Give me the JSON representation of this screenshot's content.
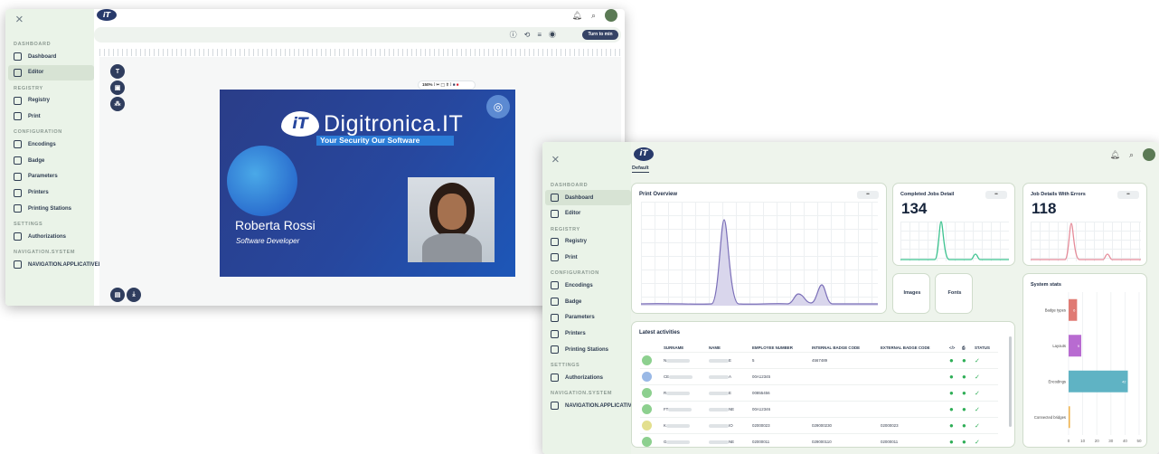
{
  "editor_window": {
    "top_icons": {
      "bell": "bell-icon",
      "search": "search-icon"
    },
    "toolbar": {
      "turn_button": "Turn to min"
    },
    "zoom": "150%",
    "sidebar": {
      "sections": [
        {
          "title": "DASHBOARD",
          "items": [
            "Dashboard",
            "Editor"
          ]
        },
        {
          "title": "REGISTRY",
          "items": [
            "Registry",
            "Print"
          ]
        },
        {
          "title": "CONFIGURATION",
          "items": [
            "Encodings",
            "Badge",
            "Parameters",
            "Printers",
            "Printing Stations"
          ]
        },
        {
          "title": "SETTINGS",
          "items": [
            "Authorizations"
          ]
        },
        {
          "title": "NAVIGATION.SYSTEM",
          "items": [
            "NAVIGATION.APPLICATIVELO"
          ]
        }
      ],
      "active": "Editor"
    },
    "tools": [
      "T"
    ],
    "badge": {
      "brand": "Digitronica.IT",
      "slogan": "Your Security Our Software",
      "person_name": "Roberta Rossi",
      "person_role": "Software Developer",
      "colors": {
        "bg_start": "#2a3f8f",
        "bg_end": "#1d57b8",
        "slogan_bar": "#2b7dd8"
      }
    }
  },
  "dashboard_window": {
    "tab": "Default",
    "sidebar": {
      "sections": [
        {
          "title": "DASHBOARD",
          "items": [
            "Dashboard",
            "Editor"
          ]
        },
        {
          "title": "REGISTRY",
          "items": [
            "Registry",
            "Print"
          ]
        },
        {
          "title": "CONFIGURATION",
          "items": [
            "Encodings",
            "Badge",
            "Parameters",
            "Printers",
            "Printing Stations"
          ]
        },
        {
          "title": "SETTINGS",
          "items": [
            "Authorizations"
          ]
        },
        {
          "title": "NAVIGATION.SYSTEM",
          "items": [
            "NAVIGATION.APPLICATIVELO"
          ]
        }
      ],
      "active": "Dashboard"
    },
    "print_overview": {
      "title": "Print Overview",
      "chip": "••"
    },
    "completed": {
      "title": "Completed Jobs Detail",
      "value": "134",
      "chip": "••"
    },
    "errors": {
      "title": "Job Details With Errors",
      "value": "118",
      "chip": "••"
    },
    "shortcuts": [
      "Images",
      "Fonts"
    ],
    "system_stats": {
      "title": "System stats",
      "chart_data": {
        "type": "bar",
        "orientation": "horizontal",
        "categories": [
          "Badge types",
          "Layouts",
          "Encodings",
          "Connected bridges"
        ],
        "values": [
          6,
          9,
          42,
          1
        ],
        "data_labels": [
          "6",
          "9",
          "42",
          ""
        ],
        "colors": [
          "#e07a73",
          "#b86bd1",
          "#5fb3c4",
          "#f0b14b"
        ],
        "xticks": [
          "0",
          "10",
          "20",
          "30",
          "40",
          "50"
        ],
        "xlim": [
          0,
          50
        ]
      }
    },
    "activities": {
      "title": "Latest activities",
      "columns": [
        "SURNAME",
        "NAME",
        "EMPLOYEE NUMBER",
        "INTERNAL BADGE CODE",
        "EXTERNAL BADGE CODE",
        "STATUS"
      ],
      "rows": [
        {
          "init": "CM",
          "surname": "N",
          "name": "E",
          "emp": "5",
          "internal": "4567489",
          "external": "",
          "color": "#8dd08f"
        },
        {
          "init": "CC",
          "surname": "CE",
          "name": "A",
          "emp": "00A12345",
          "internal": "",
          "external": "",
          "color": "#9ab9e6"
        },
        {
          "init": "RR",
          "surname": "R",
          "name": "E",
          "emp": "00855456",
          "internal": "",
          "external": "",
          "color": "#8dd08f"
        },
        {
          "init": "FF",
          "surname": "FT",
          "name": "NE",
          "emp": "00A12346",
          "internal": "",
          "external": "",
          "color": "#8dd08f"
        },
        {
          "init": "KK",
          "surname": "K",
          "name": "IO",
          "emp": "02000023",
          "internal": "029000230",
          "external": "02000023",
          "color": "#e3df8e"
        },
        {
          "init": "GG",
          "surname": "G",
          "name": "NE",
          "emp": "02000011",
          "internal": "029000110",
          "external": "02000011",
          "color": "#8dd08f"
        }
      ]
    }
  }
}
